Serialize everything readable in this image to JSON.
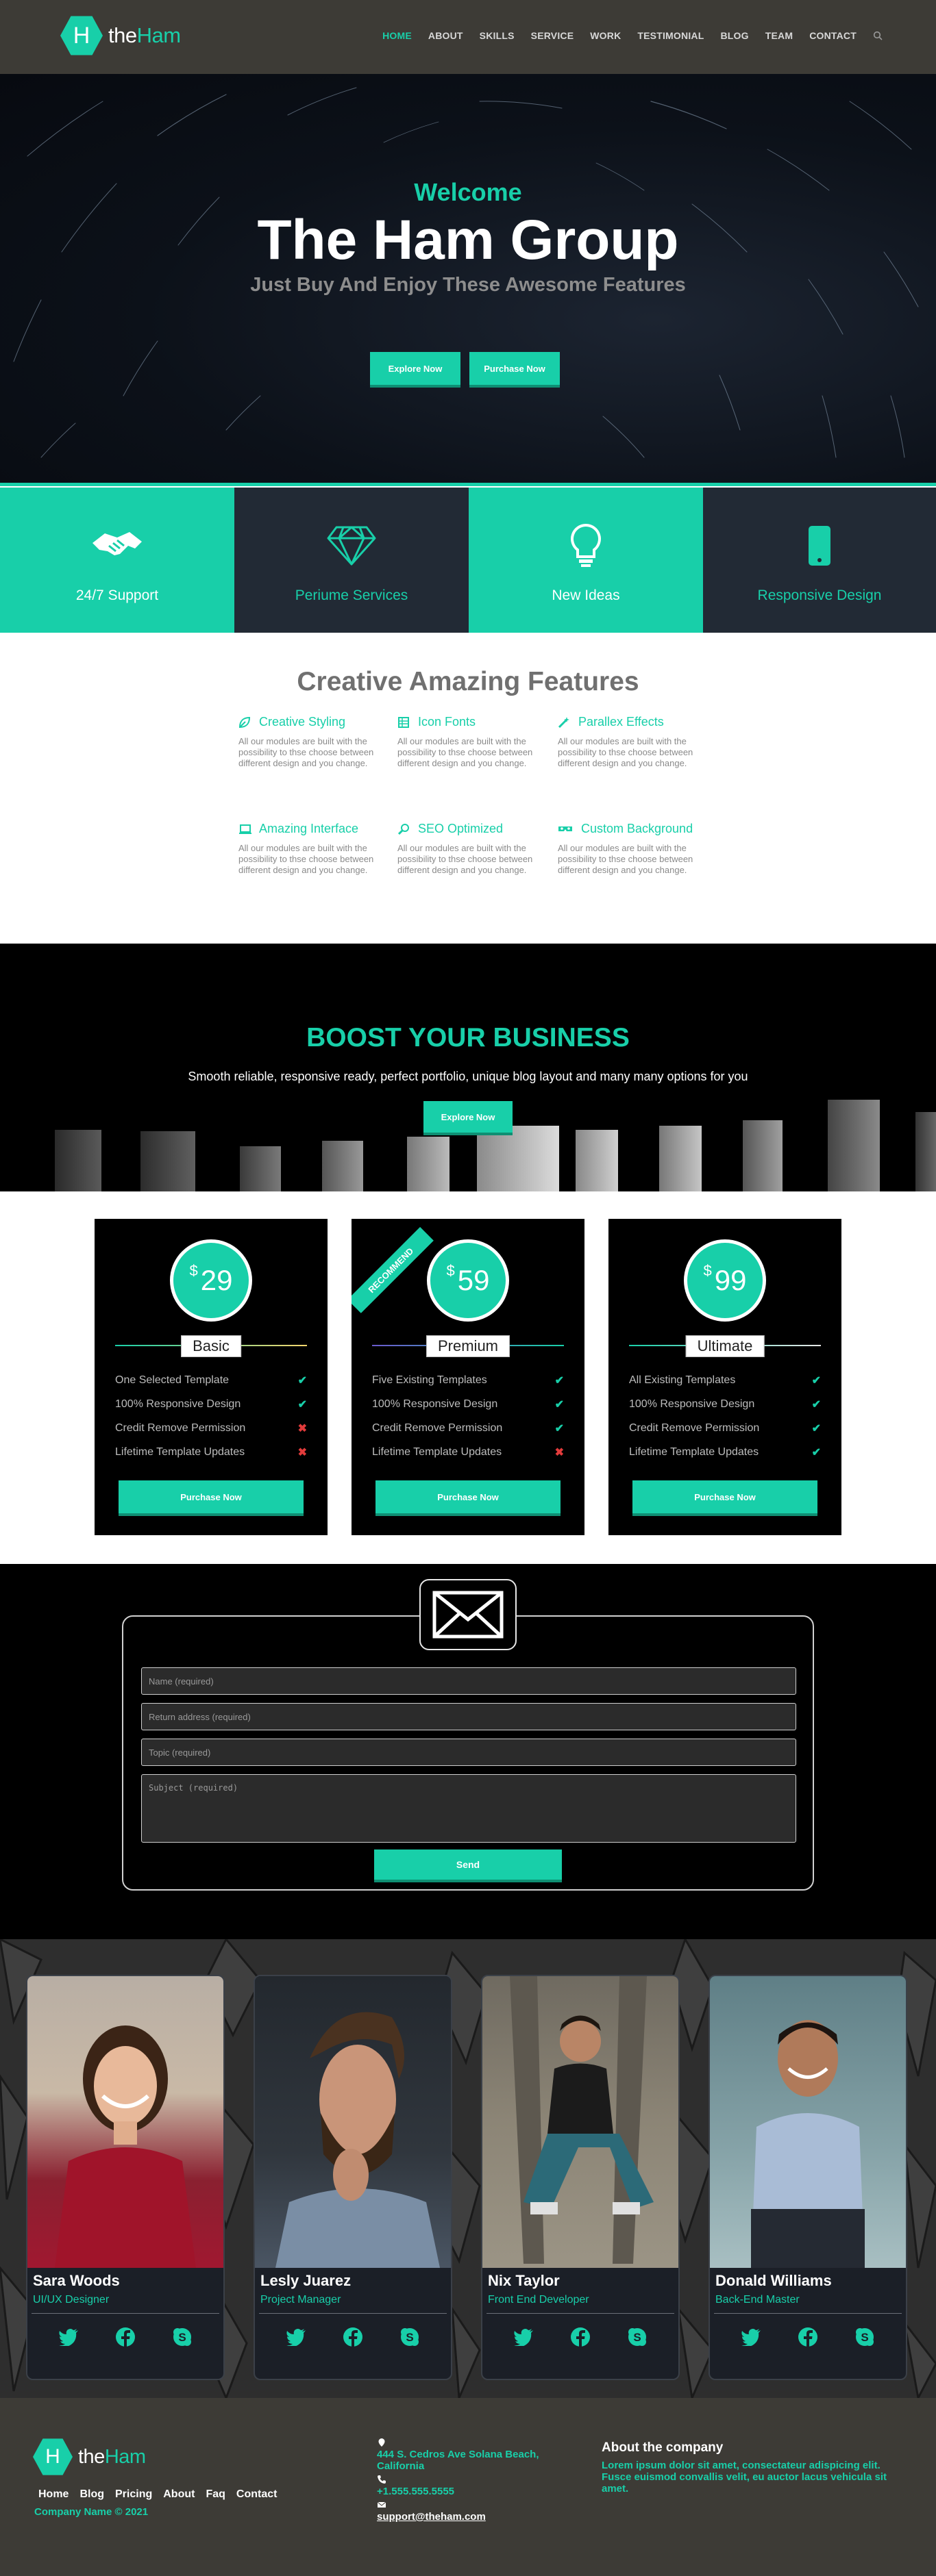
{
  "brand": {
    "mark": "H",
    "name_a": "the",
    "name_b": "Ham",
    "accent": "#18cfa9"
  },
  "nav": {
    "items": [
      "HOME",
      "ABOUT",
      "SKILLS",
      "SERVICE",
      "WORK",
      "TESTIMONIAL",
      "BLOG",
      "TEAM",
      "CONTACT"
    ],
    "active": "HOME",
    "search_icon": "search-icon"
  },
  "hero": {
    "welcome": "Welcome",
    "title": "The Ham Group",
    "subtitle": "Just Buy And Enjoy These Awesome Features",
    "btn_explore": "Explore Now",
    "btn_purchase": "Purchase Now"
  },
  "services": [
    {
      "label": "24/7 Support",
      "icon": "handshake-icon"
    },
    {
      "label": "Periume Services",
      "icon": "diamond-icon"
    },
    {
      "label": "New Ideas",
      "icon": "lightbulb-icon"
    },
    {
      "label": "Responsive Design",
      "icon": "mobile-icon"
    }
  ],
  "features": {
    "title": "Creative Amazing Features",
    "items": [
      {
        "title": "Creative Styling",
        "icon": "leaf-icon",
        "desc": "All our modules are built with the possibility to thse choose between different design and you change."
      },
      {
        "title": "Icon Fonts",
        "icon": "grid-icon",
        "desc": "All our modules are built with the possibility to thse choose between different design and you change."
      },
      {
        "title": "Parallex Effects",
        "icon": "magic-icon",
        "desc": "All our modules are built with the possibility to thse choose between different design and you change."
      },
      {
        "title": "Amazing Interface",
        "icon": "laptop-icon",
        "desc": "All our modules are built with the possibility to thse choose between different design and you change."
      },
      {
        "title": "SEO Optimized",
        "icon": "search-icon",
        "desc": "All our modules are built with the possibility to thse choose between different design and you change."
      },
      {
        "title": "Custom Background",
        "icon": "mask-icon",
        "desc": "All our modules are built with the possibility to thse choose between different design and you change."
      }
    ]
  },
  "boost": {
    "title": "BOOST YOUR BUSINESS",
    "subtitle": "Smooth reliable, responsive ready, perfect portfolio, unique blog layout and many many options for you",
    "button": "Explore Now"
  },
  "pricing": {
    "currency": "$",
    "ribbon": "RECOMMEND",
    "button": "Purchase Now",
    "plans": [
      {
        "name": "Basic",
        "price": "29",
        "features": [
          {
            "text": "One Selected Template",
            "ok": true
          },
          {
            "text": "100% Responsive Design",
            "ok": true
          },
          {
            "text": "Credit Remove Permission",
            "ok": false
          },
          {
            "text": "Lifetime Template Updates",
            "ok": false
          }
        ]
      },
      {
        "name": "Premium",
        "price": "59",
        "features": [
          {
            "text": "Five Existing Templates",
            "ok": true
          },
          {
            "text": "100% Responsive Design",
            "ok": true
          },
          {
            "text": "Credit Remove Permission",
            "ok": true
          },
          {
            "text": "Lifetime Template Updates",
            "ok": false
          }
        ]
      },
      {
        "name": "Ultimate",
        "price": "99",
        "features": [
          {
            "text": "All Existing Templates",
            "ok": true
          },
          {
            "text": "100% Responsive Design",
            "ok": true
          },
          {
            "text": "Credit Remove Permission",
            "ok": true
          },
          {
            "text": "Lifetime Template Updates",
            "ok": true
          }
        ]
      }
    ]
  },
  "contact": {
    "name_ph": "Name (required)",
    "email_ph": "Return address (required)",
    "topic_ph": "Topic (required)",
    "subject_ph": "Subject (required)",
    "send": "Send"
  },
  "team": [
    {
      "name": "Sara Woods",
      "role": "UI/UX Designer"
    },
    {
      "name": "Lesly Juarez",
      "role": "Project Manager"
    },
    {
      "name": "Nix Taylor",
      "role": "Front End Developer"
    },
    {
      "name": "Donald Williams",
      "role": "Back-End Master"
    }
  ],
  "footer": {
    "links": [
      "Home",
      "Blog",
      "Pricing",
      "About",
      "Faq",
      "Contact"
    ],
    "copyright": "Company Name © 2021",
    "address": "444 S. Cedros Ave Solana Beach, California",
    "phone": "+1.555.555.5555",
    "email": "support@theham.com",
    "about_title": "About the company",
    "about_text": "Lorem ipsum dolor sit amet, consectateur adispicing elit. Fusce euismod convallis velit, eu auctor lacus vehicula sit amet."
  }
}
